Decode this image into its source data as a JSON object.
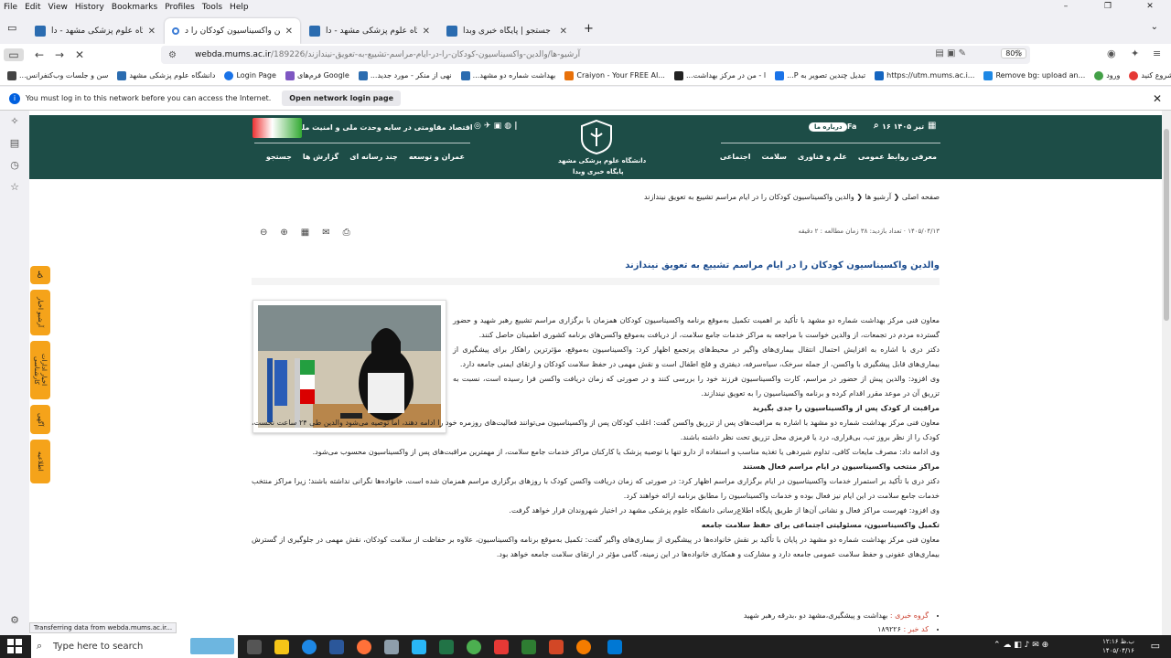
{
  "menubar": {
    "items": [
      "File",
      "Edit",
      "View",
      "History",
      "Bookmarks",
      "Profiles",
      "Tools",
      "Help"
    ]
  },
  "window_controls": [
    "–",
    "❐",
    "✕"
  ],
  "tabs": [
    {
      "title": "دانشگاه علوم پزشکی مشهد - دا...",
      "close": "✕",
      "color": "#2b6cb0"
    },
    {
      "title": "والدین واکسیناسیون کودکان را د...",
      "close": "✕",
      "color": "#3a7bd5"
    },
    {
      "title": "دانشگاه علوم پزشکی مشهد - دا...",
      "close": "✕",
      "color": "#2b6cb0"
    },
    {
      "title": "جستجو | پایگاه خبری وبدا",
      "close": "✕",
      "color": "#2b6cb0"
    }
  ],
  "new_tab": "+",
  "address": {
    "host": "webda.mums.ac.ir",
    "path": "/آرشیو-ها/والدین-واکسیناسیون-کودکان-را-در-ایام-مراسم-تشییع-به-تعویق-نیندازند/189226",
    "zoom": "80%"
  },
  "bookmarks": [
    {
      "label": "...سن و جلسات وب‌کنفرانس",
      "color": "#444"
    },
    {
      "label": "دانشگاه علوم پزشکی مشهد",
      "color": "#2b6cb0"
    },
    {
      "label": "Login Page",
      "color": "#1a73e8"
    },
    {
      "label": "فرم‌های Google",
      "color": "#7e57c2"
    },
    {
      "label": "...نهی از منکر - مورد جدید",
      "color": "#2b6cb0"
    },
    {
      "label": "...بهداشت شماره دو مشهد",
      "color": "#2b6cb0"
    },
    {
      "label": "Craiyon - Your FREE AI...",
      "color": "#e8710a"
    },
    {
      "label": "...ا - من در مرکز بهداشت",
      "color": "#222"
    },
    {
      "label": "...P تبدیل چندین تصویر به",
      "color": "#1a73e8"
    },
    {
      "label": "https://utm.mums.ac.i...",
      "color": "#1565c0"
    },
    {
      "label": "Remove bg: upload an...",
      "color": "#1e88e5"
    },
    {
      "label": "ورود",
      "color": "#43a047"
    },
    {
      "label": "پرس آنلاین - (شروع کنید ...",
      "color": "#e53935"
    }
  ],
  "notification": {
    "text": "You must log in to this network before you can access the Internet.",
    "button": "Open network login page"
  },
  "site": {
    "date": "۱۶ تیر ۱۴۰۵",
    "about": "درباره ما",
    "lang": "Fa",
    "slogan": "اقتصاد مقاومتی در سایه وحدت ملی و امنیت ملی",
    "logo_line1": "دانشگاه علوم پزشکی مشهد",
    "logo_line2": "پایگاه خبری وبدا",
    "nav_right": [
      "معرفی روابط عمومی",
      "علم و فناوری",
      "سلامت",
      "اجتماعی"
    ],
    "nav_left": [
      "عمران و توسعه",
      "چند رسانه ای",
      "گزارش ها",
      "جستجو"
    ],
    "side_tabs": [
      "♿",
      "آرشیو اخبار",
      "اخبار ادارات کارشناسی",
      "آگهی",
      "اطلاعیه"
    ]
  },
  "breadcrumb": "صفحه اصلی  ❮  آرشیو ها  ❮  والدین واکسیناسیون کودکان را در ایام مراسم تشییع به تعویق نیندازند",
  "meta": "۱۴۰۵/۰۴/۱۳  ·  تعداد بازدید: ۳۸   زمان مطالعه : ۲ دقیقه",
  "title": "والدین واکسیناسیون کودکان را در ایام مراسم تشییع به تعویق نیندازند",
  "article": {
    "p1": "معاون فنی مرکز بهداشت شماره دو مشهد با تأکید بر اهمیت تکمیل به‌موقع برنامه واکسیناسیون کودکان همزمان با برگزاری مراسم تشییع رهبر شهید و حضور گسترده مردم در تجمعات، از والدین خواست با مراجعه به مراکز خدمات جامع سلامت، از دریافت به‌موقع واکسن‌های برنامه کشوری اطمینان حاصل کنند.",
    "p2": "دکتر دری با اشاره به افزایش احتمال انتقال بیماری‌های واگیر در محیط‌های پرتجمع اظهار کرد: واکسیناسیون به‌موقع، مؤثرترین راهکار برای پیشگیری از بیماری‌های قابل پیشگیری با واکسن، از جمله سرخک، سیاه‌سرفه، دیفتری و فلج اطفال است و نقش مهمی در حفظ سلامت کودکان و ارتقای ایمنی جامعه دارد.",
    "p3": "وی افزود: والدین پیش از حضور در مراسم، کارت واکسیناسیون فرزند خود را بررسی کنند و در صورتی که زمان دریافت واکسن فرا رسیده است، نسبت به تزریق آن در موعد مقرر اقدام کرده و برنامه واکسیناسیون را به تعویق نیندازند.",
    "h1": "مراقبت از کودک پس از واکسیناسیون را جدی بگیرید",
    "p4": "معاون فنی مرکز بهداشت شماره دو مشهد با اشاره به مراقبت‌های پس از تزریق واکسن گفت: اغلب کودکان پس از واکسیناسیون می‌توانند فعالیت‌های روزمره خود را ادامه دهند، اما توصیه می‌شود والدین طی ۲۴ ساعت نخست، کودک را از نظر بروز تب، بی‌قراری، درد یا قرمزی محل تزریق تحت نظر داشته باشند.",
    "p5": "وی ادامه داد: مصرف مایعات کافی، تداوم شیردهی یا تغذیه مناسب و استفاده از دارو تنها با توصیه پزشک یا کارکنان مراکز خدمات جامع سلامت، از مهمترین مراقبت‌های پس از واکسیناسیون محسوب می‌شود.",
    "h2": "مراکز منتخب واکسیناسیون در ایام مراسم فعال هستند",
    "p6": "دکتر دری با تأکید بر استمرار خدمات واکسیناسیون در ایام برگزاری مراسم اظهار کرد: در صورتی که زمان دریافت واکسن کودک با روزهای برگزاری مراسم همزمان شده است، خانواده‌ها نگرانی نداشته باشند؛ زیرا مراکز منتخب خدمات جامع سلامت در این ایام نیز فعال بوده و خدمات واکسیناسیون را مطابق برنامه ارائه خواهند کرد.",
    "p7": "وی افزود: فهرست مراکز فعال و نشانی آن‌ها از طریق پایگاه اطلاع‌رسانی دانشگاه علوم پزشکی مشهد در اختیار شهروندان قرار خواهد گرفت.",
    "h3": "تکمیل واکسیناسیون، مسئولیتی اجتماعی برای حفظ سلامت جامعه",
    "p8": "معاون فنی مرکز بهداشت شماره دو مشهد در پایان با تأکید بر نقش خانواده‌ها در پیشگیری از بیماری‌های واگیر گفت: تکمیل به‌موقع برنامه واکسیناسیون، علاوه بر حفاظت از سلامت کودکان، نقش مهمی در جلوگیری از گسترش بیماری‌های عفونی و حفظ سلامت عمومی جامعه دارد و مشارکت و همکاری خانواده‌ها در این زمینه، گامی مؤثر در ارتقای سلامت جامعه خواهد بود."
  },
  "tags": [
    {
      "key": "گروه خبری :",
      "value": "بهداشت و پیشگیری،مشهد دو ،بدرقه رهبر شهید"
    },
    {
      "key": "کد خبر :",
      "value": "۱۸۹۲۲۶"
    }
  ],
  "status": "Transferring data from webda.mums.ac.ir...",
  "taskbar": {
    "search": "Type here to search",
    "time": "۱۲:۱۶ ب.ظ",
    "date": "۱۴۰۵/۰۴/۱۶"
  }
}
